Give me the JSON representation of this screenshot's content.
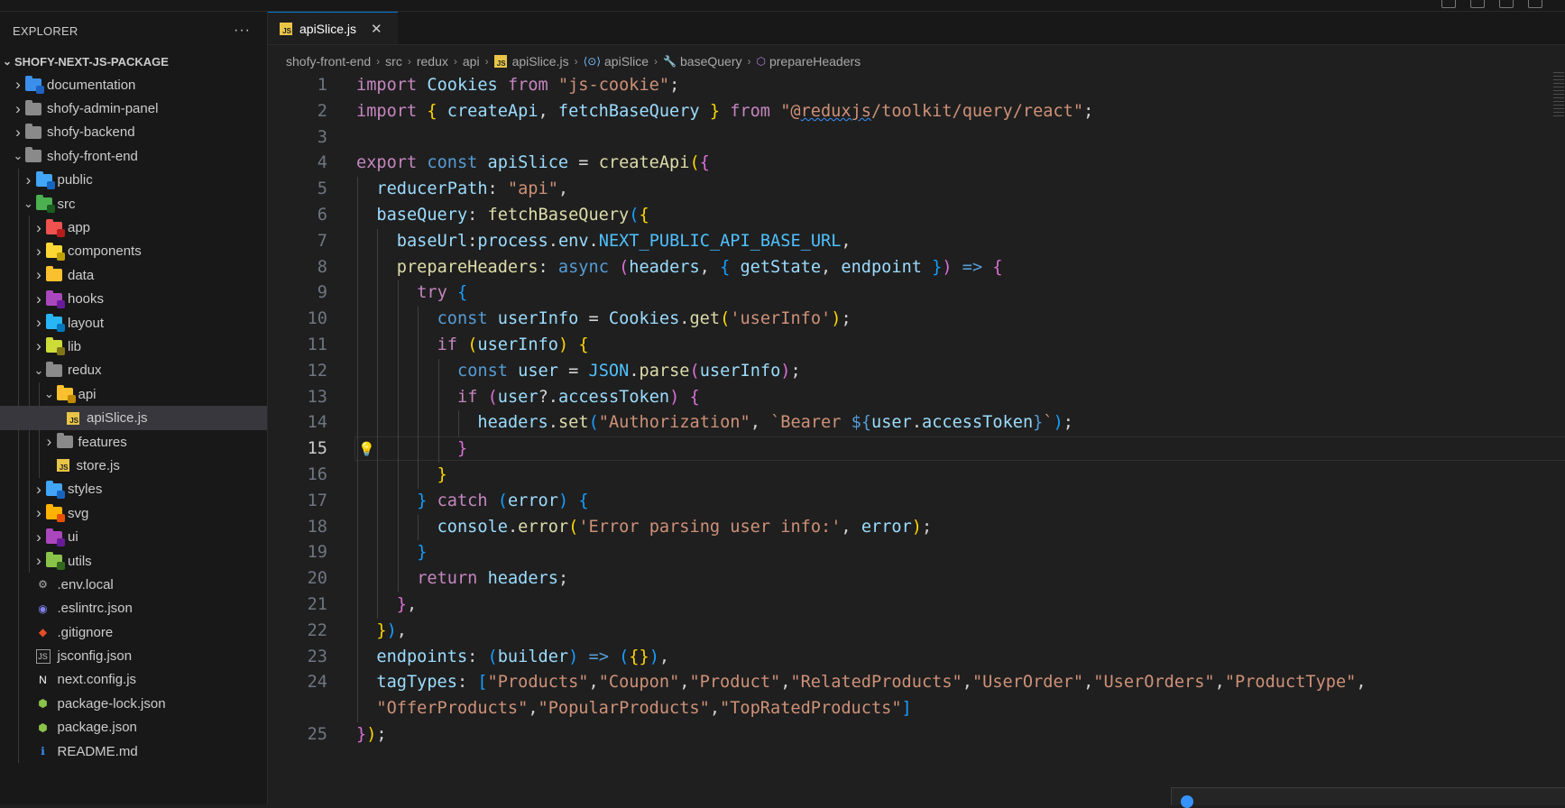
{
  "explorer": {
    "title": "EXPLORER",
    "more_label": "···",
    "root": "SHOFY-NEXT-JS-PACKAGE",
    "items": [
      {
        "label": "documentation",
        "kind": "folder",
        "depth": 0,
        "expanded": false,
        "color": "#3b8eea",
        "badge": "#1e63c2"
      },
      {
        "label": "shofy-admin-panel",
        "kind": "folder",
        "depth": 0,
        "expanded": false,
        "color": "#8a8a8a"
      },
      {
        "label": "shofy-backend",
        "kind": "folder",
        "depth": 0,
        "expanded": false,
        "color": "#8a8a8a"
      },
      {
        "label": "shofy-front-end",
        "kind": "folder",
        "depth": 0,
        "expanded": true,
        "color": "#8a8a8a"
      },
      {
        "label": "public",
        "kind": "folder",
        "depth": 1,
        "expanded": false,
        "color": "#42a5f5",
        "badge": "#1565c0"
      },
      {
        "label": "src",
        "kind": "folder",
        "depth": 1,
        "expanded": true,
        "color": "#4caf50",
        "badge": "#1b5e20"
      },
      {
        "label": "app",
        "kind": "folder",
        "depth": 2,
        "expanded": false,
        "color": "#ef5350",
        "badge": "#b71c1c"
      },
      {
        "label": "components",
        "kind": "folder",
        "depth": 2,
        "expanded": false,
        "color": "#fdd835",
        "badge": "#c0a000"
      },
      {
        "label": "data",
        "kind": "folder",
        "depth": 2,
        "expanded": false,
        "color": "#fbc02d"
      },
      {
        "label": "hooks",
        "kind": "folder",
        "depth": 2,
        "expanded": false,
        "color": "#ab47bc",
        "badge": "#6a1b9a"
      },
      {
        "label": "layout",
        "kind": "folder",
        "depth": 2,
        "expanded": false,
        "color": "#29b6f6",
        "badge": "#0277bd"
      },
      {
        "label": "lib",
        "kind": "folder",
        "depth": 2,
        "expanded": false,
        "color": "#cddc39",
        "badge": "#827717"
      },
      {
        "label": "redux",
        "kind": "folder",
        "depth": 2,
        "expanded": true,
        "color": "#8a8a8a"
      },
      {
        "label": "api",
        "kind": "folder",
        "depth": 3,
        "expanded": true,
        "color": "#fbc02d",
        "badge": "#c08a00"
      },
      {
        "label": "apiSlice.js",
        "kind": "js",
        "depth": 4,
        "selected": true
      },
      {
        "label": "features",
        "kind": "folder",
        "depth": 3,
        "expanded": false,
        "color": "#8a8a8a"
      },
      {
        "label": "store.js",
        "kind": "js",
        "depth": 3
      },
      {
        "label": "styles",
        "kind": "folder",
        "depth": 2,
        "expanded": false,
        "color": "#42a5f5",
        "badge": "#1565c0"
      },
      {
        "label": "svg",
        "kind": "folder",
        "depth": 2,
        "expanded": false,
        "color": "#ffb300",
        "badge": "#e65100"
      },
      {
        "label": "ui",
        "kind": "folder",
        "depth": 2,
        "expanded": false,
        "color": "#ab47bc",
        "badge": "#6a1b9a"
      },
      {
        "label": "utils",
        "kind": "folder",
        "depth": 2,
        "expanded": false,
        "color": "#8bc34a",
        "badge": "#33691e"
      },
      {
        "label": ".env.local",
        "kind": "env",
        "depth": 1
      },
      {
        "label": ".eslintrc.json",
        "kind": "eslint",
        "depth": 1
      },
      {
        "label": ".gitignore",
        "kind": "git",
        "depth": 1
      },
      {
        "label": "jsconfig.json",
        "kind": "jsconfig",
        "depth": 1
      },
      {
        "label": "next.config.js",
        "kind": "next",
        "depth": 1
      },
      {
        "label": "package-lock.json",
        "kind": "npm",
        "depth": 1
      },
      {
        "label": "package.json",
        "kind": "npm",
        "depth": 1
      },
      {
        "label": "README.md",
        "kind": "info",
        "depth": 1
      }
    ]
  },
  "tab": {
    "label": "apiSlice.js",
    "close": "✕"
  },
  "breadcrumb": [
    "shofy-front-end",
    "src",
    "redux",
    "api",
    "apiSlice.js",
    "apiSlice",
    "baseQuery",
    "prepareHeaders"
  ],
  "editor": {
    "current_line": 15,
    "lines": [
      {
        "n": "1",
        "i": 0,
        "t": [
          [
            "k",
            "import "
          ],
          [
            "v",
            "Cookies "
          ],
          [
            "k",
            "from "
          ],
          [
            "s",
            "\"js-cookie\""
          ],
          [
            "p",
            ";"
          ]
        ]
      },
      {
        "n": "2",
        "i": 0,
        "t": [
          [
            "k",
            "import "
          ],
          [
            "b1",
            "{ "
          ],
          [
            "v",
            "createApi"
          ],
          [
            "p",
            ", "
          ],
          [
            "v",
            "fetchBaseQuery "
          ],
          [
            "b1",
            "} "
          ],
          [
            "k",
            "from "
          ],
          [
            "s",
            "\"@"
          ],
          [
            "sq",
            "reduxjs"
          ],
          [
            "s",
            "/toolkit/query/react\""
          ],
          [
            "p",
            ";"
          ]
        ]
      },
      {
        "n": "3",
        "i": 0,
        "t": []
      },
      {
        "n": "4",
        "i": 0,
        "t": [
          [
            "k",
            "export "
          ],
          [
            "d",
            "const "
          ],
          [
            "v",
            "apiSlice "
          ],
          [
            "p",
            "= "
          ],
          [
            "f",
            "createApi"
          ],
          [
            "b1",
            "("
          ],
          [
            "b2",
            "{"
          ]
        ]
      },
      {
        "n": "5",
        "i": 1,
        "t": [
          [
            "v",
            "reducerPath"
          ],
          [
            "p",
            ": "
          ],
          [
            "s",
            "\"api\""
          ],
          [
            "p",
            ","
          ]
        ]
      },
      {
        "n": "6",
        "i": 1,
        "t": [
          [
            "v",
            "baseQuery"
          ],
          [
            "p",
            ": "
          ],
          [
            "f",
            "fetchBaseQuery"
          ],
          [
            "b3",
            "("
          ],
          [
            "b1",
            "{"
          ]
        ]
      },
      {
        "n": "7",
        "i": 2,
        "t": [
          [
            "v",
            "baseUrl"
          ],
          [
            "p",
            ":"
          ],
          [
            "v",
            "process"
          ],
          [
            "p",
            "."
          ],
          [
            "v",
            "env"
          ],
          [
            "p",
            "."
          ],
          [
            "co",
            "NEXT_PUBLIC_API_BASE_URL"
          ],
          [
            "p",
            ","
          ]
        ]
      },
      {
        "n": "8",
        "i": 2,
        "t": [
          [
            "f",
            "prepareHeaders"
          ],
          [
            "p",
            ": "
          ],
          [
            "d",
            "async "
          ],
          [
            "b2",
            "("
          ],
          [
            "v",
            "headers"
          ],
          [
            "p",
            ", "
          ],
          [
            "b3",
            "{ "
          ],
          [
            "v",
            "getState"
          ],
          [
            "p",
            ", "
          ],
          [
            "v",
            "endpoint "
          ],
          [
            "b3",
            "}"
          ],
          [
            "b2",
            ")"
          ],
          [
            "d",
            " => "
          ],
          [
            "b2",
            "{"
          ]
        ]
      },
      {
        "n": "9",
        "i": 3,
        "t": [
          [
            "k",
            "try "
          ],
          [
            "b3",
            "{"
          ]
        ]
      },
      {
        "n": "10",
        "i": 4,
        "t": [
          [
            "d",
            "const "
          ],
          [
            "v",
            "userInfo "
          ],
          [
            "p",
            "= "
          ],
          [
            "v",
            "Cookies"
          ],
          [
            "p",
            "."
          ],
          [
            "f",
            "get"
          ],
          [
            "b1",
            "("
          ],
          [
            "s",
            "'userInfo'"
          ],
          [
            "b1",
            ")"
          ],
          [
            "p",
            ";"
          ]
        ]
      },
      {
        "n": "11",
        "i": 4,
        "t": [
          [
            "k",
            "if "
          ],
          [
            "b1",
            "("
          ],
          [
            "v",
            "userInfo"
          ],
          [
            "b1",
            ") "
          ],
          [
            "b1",
            "{"
          ]
        ]
      },
      {
        "n": "12",
        "i": 5,
        "t": [
          [
            "d",
            "const "
          ],
          [
            "v",
            "user "
          ],
          [
            "p",
            "= "
          ],
          [
            "co",
            "JSON"
          ],
          [
            "p",
            "."
          ],
          [
            "f",
            "parse"
          ],
          [
            "b2",
            "("
          ],
          [
            "v",
            "userInfo"
          ],
          [
            "b2",
            ")"
          ],
          [
            "p",
            ";"
          ]
        ]
      },
      {
        "n": "13",
        "i": 5,
        "t": [
          [
            "k",
            "if "
          ],
          [
            "b2",
            "("
          ],
          [
            "v",
            "user"
          ],
          [
            "p",
            "?."
          ],
          [
            "v",
            "accessToken"
          ],
          [
            "b2",
            ") "
          ],
          [
            "b2",
            "{"
          ]
        ]
      },
      {
        "n": "14",
        "i": 6,
        "t": [
          [
            "v",
            "headers"
          ],
          [
            "p",
            "."
          ],
          [
            "f",
            "set"
          ],
          [
            "b3",
            "("
          ],
          [
            "s",
            "\"Authorization\""
          ],
          [
            "p",
            ", "
          ],
          [
            "s",
            "`Bearer "
          ],
          [
            "d",
            "${"
          ],
          [
            "v",
            "user"
          ],
          [
            "p",
            "."
          ],
          [
            "v",
            "accessToken"
          ],
          [
            "d",
            "}"
          ],
          [
            "s",
            "`"
          ],
          [
            "b3",
            ")"
          ],
          [
            "p",
            ";"
          ]
        ]
      },
      {
        "n": "15",
        "i": 5,
        "t": [
          [
            "b2",
            "}"
          ]
        ]
      },
      {
        "n": "16",
        "i": 4,
        "t": [
          [
            "b1",
            "}"
          ]
        ]
      },
      {
        "n": "17",
        "i": 3,
        "t": [
          [
            "b3",
            "} "
          ],
          [
            "k",
            "catch "
          ],
          [
            "b3",
            "("
          ],
          [
            "v",
            "error"
          ],
          [
            "b3",
            ") "
          ],
          [
            "b3",
            "{"
          ]
        ]
      },
      {
        "n": "18",
        "i": 4,
        "t": [
          [
            "v",
            "console"
          ],
          [
            "p",
            "."
          ],
          [
            "f",
            "error"
          ],
          [
            "b1",
            "("
          ],
          [
            "s",
            "'Error parsing user info:'"
          ],
          [
            "p",
            ", "
          ],
          [
            "v",
            "error"
          ],
          [
            "b1",
            ")"
          ],
          [
            "p",
            ";"
          ]
        ]
      },
      {
        "n": "19",
        "i": 3,
        "t": [
          [
            "b3",
            "}"
          ]
        ]
      },
      {
        "n": "20",
        "i": 3,
        "t": [
          [
            "k",
            "return "
          ],
          [
            "v",
            "headers"
          ],
          [
            "p",
            ";"
          ]
        ]
      },
      {
        "n": "21",
        "i": 2,
        "t": [
          [
            "b2",
            "}"
          ],
          [
            "p",
            ","
          ]
        ]
      },
      {
        "n": "22",
        "i": 1,
        "t": [
          [
            "b1",
            "}"
          ],
          [
            "b3",
            ")"
          ],
          [
            "p",
            ","
          ]
        ]
      },
      {
        "n": "23",
        "i": 1,
        "t": [
          [
            "v",
            "endpoints"
          ],
          [
            "p",
            ": "
          ],
          [
            "b3",
            "("
          ],
          [
            "v",
            "builder"
          ],
          [
            "b3",
            ")"
          ],
          [
            "d",
            " => "
          ],
          [
            "b3",
            "("
          ],
          [
            "b1",
            "{}"
          ],
          [
            "b3",
            ")"
          ],
          [
            "p",
            ","
          ]
        ]
      },
      {
        "n": "24",
        "i": 1,
        "t": [
          [
            "v",
            "tagTypes"
          ],
          [
            "p",
            ": "
          ],
          [
            "b3",
            "["
          ],
          [
            "s",
            "\"Products\""
          ],
          [
            "p",
            ","
          ],
          [
            "s",
            "\"Coupon\""
          ],
          [
            "p",
            ","
          ],
          [
            "s",
            "\"Product\""
          ],
          [
            "p",
            ","
          ],
          [
            "s",
            "\"RelatedProducts\""
          ],
          [
            "p",
            ","
          ],
          [
            "s",
            "\"UserOrder\""
          ],
          [
            "p",
            ","
          ],
          [
            "s",
            "\"UserOrders\""
          ],
          [
            "p",
            ","
          ],
          [
            "s",
            "\"ProductType\""
          ],
          [
            "p",
            ","
          ]
        ]
      },
      {
        "n": "",
        "i": 1,
        "t": [
          [
            "s",
            "\"OfferProducts\""
          ],
          [
            "p",
            ","
          ],
          [
            "s",
            "\"PopularProducts\""
          ],
          [
            "p",
            ","
          ],
          [
            "s",
            "\"TopRatedProducts\""
          ],
          [
            "b3",
            "]"
          ]
        ]
      },
      {
        "n": "25",
        "i": 0,
        "t": [
          [
            "b2",
            "}"
          ],
          [
            "b1",
            ")"
          ],
          [
            "p",
            ";"
          ]
        ]
      }
    ]
  }
}
